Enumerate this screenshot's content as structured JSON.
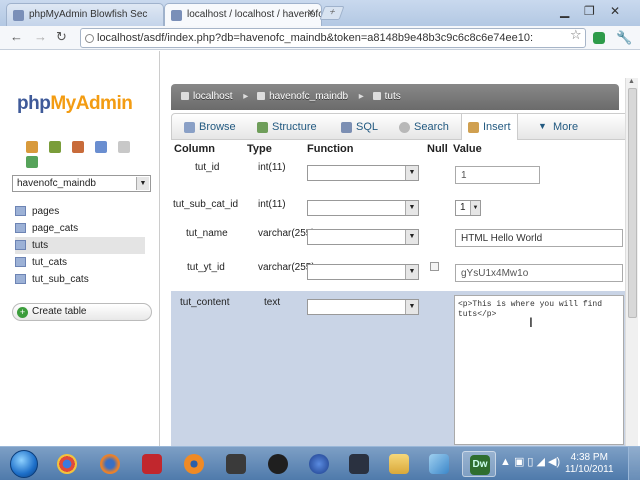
{
  "browser": {
    "tabs": [
      {
        "title": "phpMyAdmin Blowfish Sec"
      },
      {
        "title": "localhost / localhost / havenofc"
      }
    ],
    "url": "localhost/asdf/index.php?db=havenofc_maindb&token=a8148b9e48b3c9c6c8c6e74ee10:"
  },
  "sidebar": {
    "logo_php": "php",
    "logo_myadmin": "MyAdmin",
    "db_selected": "havenofc_maindb",
    "tables": [
      {
        "name": "pages"
      },
      {
        "name": "page_cats"
      },
      {
        "name": "tuts"
      },
      {
        "name": "tut_cats"
      },
      {
        "name": "tut_sub_cats"
      }
    ],
    "create_table": "Create table"
  },
  "breadcrumb": {
    "server": "localhost",
    "database": "havenofc_maindb",
    "table": "tuts",
    "sep": "▸"
  },
  "tabs": {
    "browse": "Browse",
    "structure": "Structure",
    "sql": "SQL",
    "search": "Search",
    "insert": "Insert",
    "more": "More"
  },
  "grid": {
    "headers": {
      "column": "Column",
      "type": "Type",
      "function": "Function",
      "null": "Null",
      "value": "Value"
    },
    "rows": [
      {
        "column": "tut_id",
        "type": "int(11)",
        "value": "1"
      },
      {
        "column": "tut_sub_cat_id",
        "type": "int(11)",
        "value": "1"
      },
      {
        "column": "tut_name",
        "type": "varchar(255)",
        "value": "HTML Hello World"
      },
      {
        "column": "tut_yt_id",
        "type": "varchar(255)",
        "value": "gYsU1x4Mw1o"
      },
      {
        "column": "tut_content",
        "type": "text",
        "value": "<p>This is where you will find tuts</p>"
      }
    ]
  },
  "taskbar": {
    "time": "4:38 PM",
    "date": "11/10/2011"
  },
  "colors": {
    "accent": "#235a81",
    "header_bar": "#6b6b6b",
    "selected_row": "#c9d4e6"
  }
}
